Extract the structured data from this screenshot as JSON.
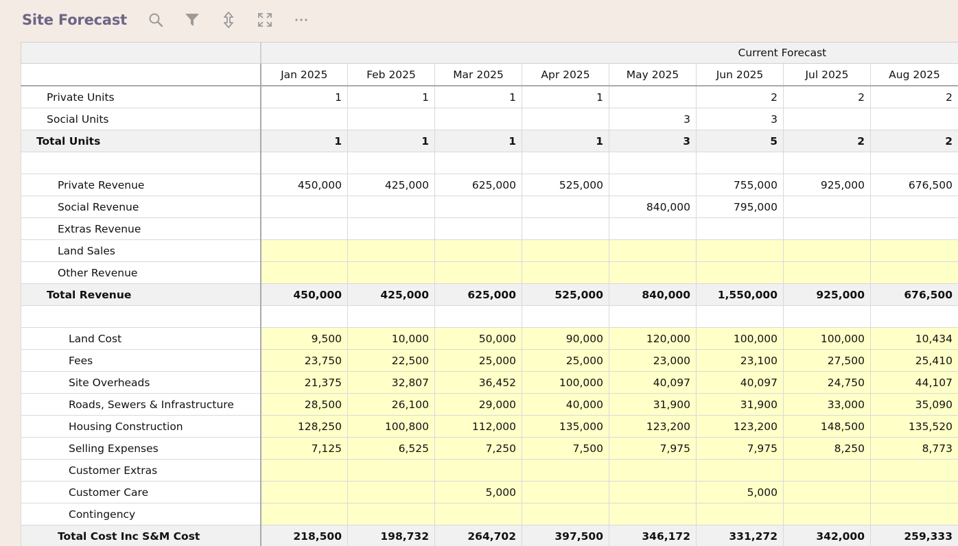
{
  "toolbar": {
    "title": "Site Forecast",
    "icons": [
      "search-icon",
      "filter-icon",
      "expand-rows-icon",
      "fullscreen-icon",
      "more-icon"
    ]
  },
  "colors": {
    "background": "#f4ebe5",
    "title": "#6c6585",
    "input_cell": "#ffffc8",
    "total_row": "#f1f1f1"
  },
  "grid": {
    "group_header": "Current Forecast",
    "columns": [
      "Jan 2025",
      "Feb 2025",
      "Mar 2025",
      "Apr 2025",
      "May 2025",
      "Jun 2025",
      "Jul 2025",
      "Aug 2025"
    ],
    "rows": [
      {
        "label": "Private Units",
        "indent": 1,
        "total": false,
        "yellow": false,
        "values": [
          "1",
          "1",
          "1",
          "1",
          "",
          "2",
          "2",
          "2"
        ]
      },
      {
        "label": "Social Units",
        "indent": 1,
        "total": false,
        "yellow": false,
        "values": [
          "",
          "",
          "",
          "",
          "3",
          "3",
          "",
          ""
        ]
      },
      {
        "label": "Total Units",
        "indent": 0,
        "total": true,
        "yellow": false,
        "values": [
          "1",
          "1",
          "1",
          "1",
          "3",
          "5",
          "2",
          "2"
        ]
      },
      {
        "label": "",
        "indent": 0,
        "total": false,
        "yellow": false,
        "values": [
          "",
          "",
          "",
          "",
          "",
          "",
          "",
          ""
        ]
      },
      {
        "label": "Private Revenue",
        "indent": 2,
        "total": false,
        "yellow": false,
        "values": [
          "450,000",
          "425,000",
          "625,000",
          "525,000",
          "",
          "755,000",
          "925,000",
          "676,500"
        ]
      },
      {
        "label": "Social Revenue",
        "indent": 2,
        "total": false,
        "yellow": false,
        "values": [
          "",
          "",
          "",
          "",
          "840,000",
          "795,000",
          "",
          ""
        ]
      },
      {
        "label": "Extras Revenue",
        "indent": 2,
        "total": false,
        "yellow": false,
        "values": [
          "",
          "",
          "",
          "",
          "",
          "",
          "",
          ""
        ]
      },
      {
        "label": "Land Sales",
        "indent": 2,
        "total": false,
        "yellow": true,
        "values": [
          "",
          "",
          "",
          "",
          "",
          "",
          "",
          ""
        ]
      },
      {
        "label": "Other Revenue",
        "indent": 2,
        "total": false,
        "yellow": true,
        "values": [
          "",
          "",
          "",
          "",
          "",
          "",
          "",
          ""
        ]
      },
      {
        "label": "Total Revenue",
        "indent": 1,
        "total": true,
        "yellow": false,
        "values": [
          "450,000",
          "425,000",
          "625,000",
          "525,000",
          "840,000",
          "1,550,000",
          "925,000",
          "676,500"
        ]
      },
      {
        "label": "",
        "indent": 0,
        "total": false,
        "yellow": false,
        "values": [
          "",
          "",
          "",
          "",
          "",
          "",
          "",
          ""
        ]
      },
      {
        "label": "Land Cost",
        "indent": 3,
        "total": false,
        "yellow": true,
        "values": [
          "9,500",
          "10,000",
          "50,000",
          "90,000",
          "120,000",
          "100,000",
          "100,000",
          "10,434"
        ]
      },
      {
        "label": "Fees",
        "indent": 3,
        "total": false,
        "yellow": true,
        "values": [
          "23,750",
          "22,500",
          "25,000",
          "25,000",
          "23,000",
          "23,100",
          "27,500",
          "25,410"
        ]
      },
      {
        "label": "Site Overheads",
        "indent": 3,
        "total": false,
        "yellow": true,
        "values": [
          "21,375",
          "32,807",
          "36,452",
          "100,000",
          "40,097",
          "40,097",
          "24,750",
          "44,107"
        ]
      },
      {
        "label": "Roads, Sewers & Infrastructure",
        "indent": 3,
        "total": false,
        "yellow": true,
        "values": [
          "28,500",
          "26,100",
          "29,000",
          "40,000",
          "31,900",
          "31,900",
          "33,000",
          "35,090"
        ]
      },
      {
        "label": "Housing Construction",
        "indent": 3,
        "total": false,
        "yellow": true,
        "values": [
          "128,250",
          "100,800",
          "112,000",
          "135,000",
          "123,200",
          "123,200",
          "148,500",
          "135,520"
        ]
      },
      {
        "label": "Selling Expenses",
        "indent": 3,
        "total": false,
        "yellow": true,
        "values": [
          "7,125",
          "6,525",
          "7,250",
          "7,500",
          "7,975",
          "7,975",
          "8,250",
          "8,773"
        ]
      },
      {
        "label": "Customer Extras",
        "indent": 3,
        "total": false,
        "yellow": true,
        "values": [
          "",
          "",
          "",
          "",
          "",
          "",
          "",
          ""
        ]
      },
      {
        "label": "Customer Care",
        "indent": 3,
        "total": false,
        "yellow": true,
        "values": [
          "",
          "",
          "5,000",
          "",
          "",
          "5,000",
          "",
          ""
        ]
      },
      {
        "label": "Contingency",
        "indent": 3,
        "total": false,
        "yellow": true,
        "values": [
          "",
          "",
          "",
          "",
          "",
          "",
          "",
          ""
        ]
      },
      {
        "label": "Total Cost Inc S&M Cost",
        "indent": 2,
        "total": true,
        "yellow": false,
        "values": [
          "218,500",
          "198,732",
          "264,702",
          "397,500",
          "346,172",
          "331,272",
          "342,000",
          "259,333"
        ]
      }
    ]
  }
}
